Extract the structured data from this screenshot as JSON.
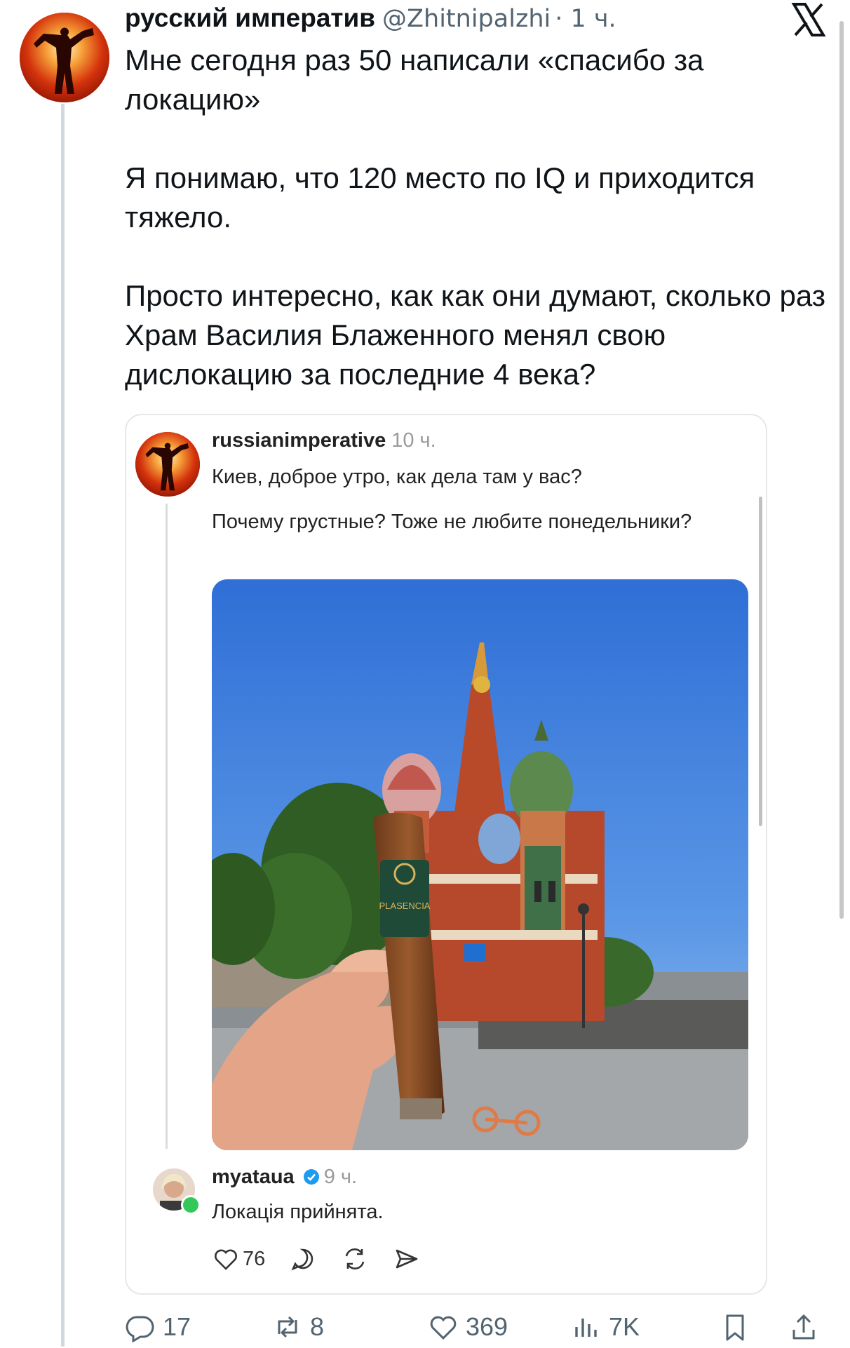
{
  "post": {
    "author_name": "русский императив",
    "author_handle": "@Zhitnipalzhi",
    "time": "· 1 ч.",
    "paragraphs": [
      "Мне сегодня раз 50 написали «спасибо за локацию»",
      "Я понимаю, что 120 место по IQ и приходится тяжело.",
      "Просто интересно, как как они думают, сколько раз Храм Василия Блаженного менял свою дислокацию за последние 4 века?"
    ]
  },
  "quoted": {
    "username": "russianimperative",
    "time": "10 ч.",
    "line1": "Киев, доброе утро, как дела там у вас?",
    "line2": "Почему грустные? Тоже не любите понедельники?",
    "photo_label": "PLASENCIA"
  },
  "reply": {
    "username": "myataua",
    "time": "9 ч.",
    "text": "Локація прийнята.",
    "likes": "76"
  },
  "actions": {
    "replies": "17",
    "reposts": "8",
    "likes": "369",
    "views": "7K"
  },
  "colors": {
    "text": "#0f1419",
    "secondary": "#536471",
    "verified": "#1d9bf0",
    "online": "#34c759"
  }
}
